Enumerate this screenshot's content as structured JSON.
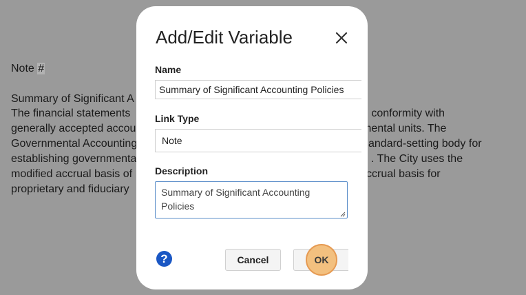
{
  "document": {
    "note_label": "Note",
    "note_hash": "#",
    "summary_heading": "Summary of Significant A",
    "body_lines": [
      {
        "left": "The financial statements",
        "right": "n conformity with"
      },
      {
        "left": "generally accepted accou",
        "right": "mental units. The"
      },
      {
        "left": "Governmental Accounting",
        "right": "andard-setting body for"
      },
      {
        "left": "establishing governmenta",
        "right": ". The City uses the"
      },
      {
        "left": "modified accrual basis of",
        "right": "ccrual basis for"
      },
      {
        "left": "proprietary and fiduciary",
        "right": ""
      }
    ]
  },
  "dialog": {
    "title": "Add/Edit Variable",
    "close_icon": "close-icon",
    "name_label": "Name",
    "name_value": "Summary of Significant Accounting Policies",
    "link_type_label": "Link Type",
    "link_type_value": "Note",
    "description_label": "Description",
    "description_value": "Summary of Significant Accounting Policies",
    "help_glyph": "?",
    "cancel_label": "Cancel",
    "ok_label": "OK"
  },
  "colors": {
    "overlay": "#9a9a9a",
    "accent_blue": "#1a57c4",
    "highlight": "#f3c07f"
  }
}
